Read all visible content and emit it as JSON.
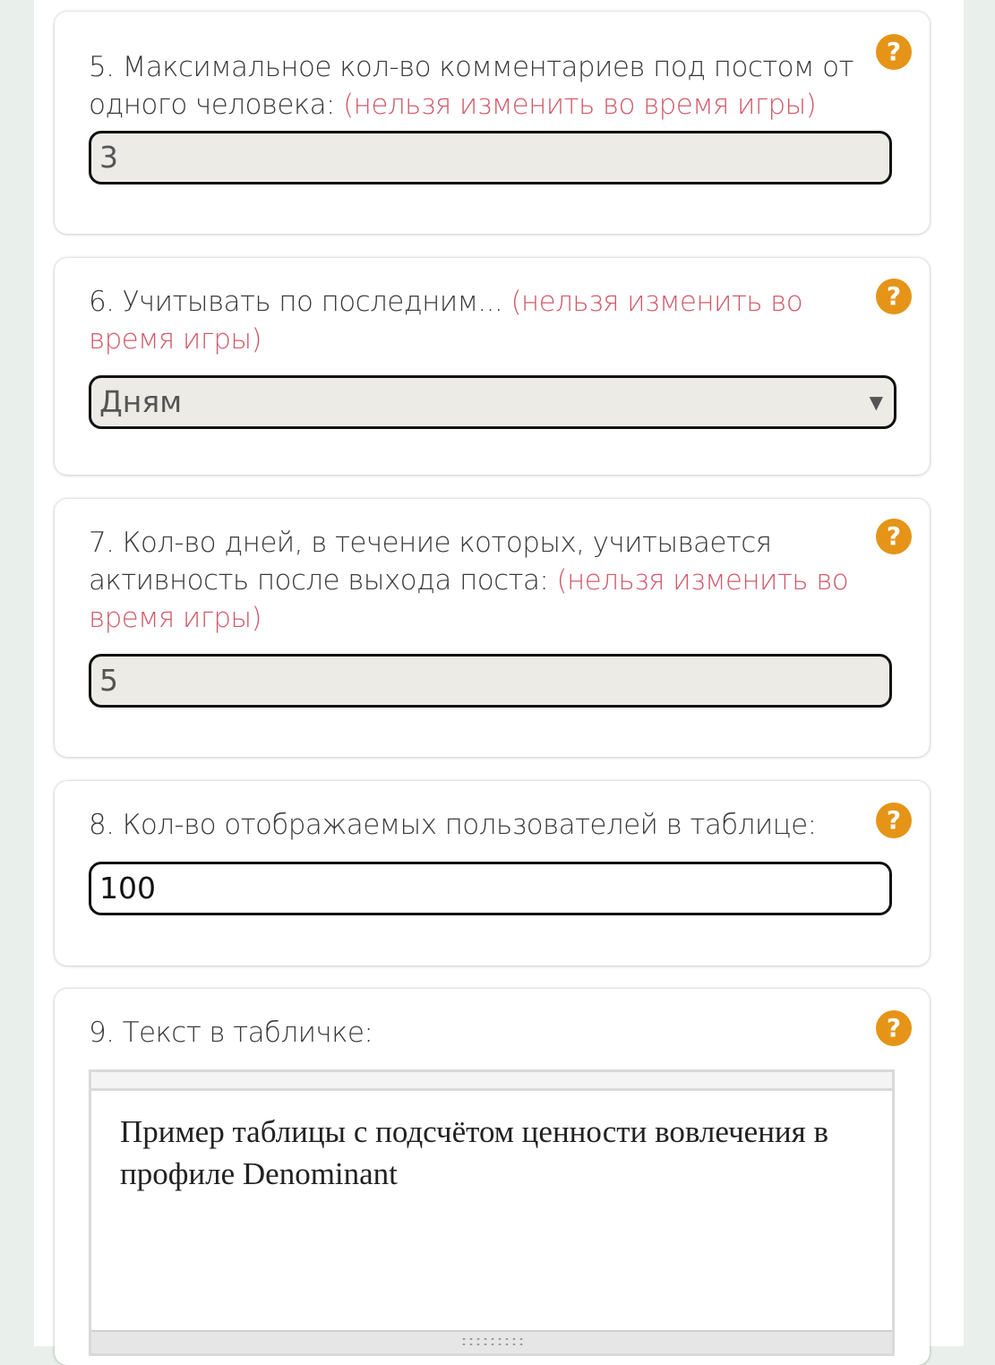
{
  "settings": [
    {
      "label": "5. Максимальное кол-во комментариев под постом от одного человека:",
      "warning": "(нельзя изменить во время игры)",
      "value": "3",
      "help": "?"
    },
    {
      "label": "6. Учитывать по последним...",
      "warning": "(нельзя изменить во время игры)",
      "value": "Дням",
      "arrow": "▼",
      "help": "?"
    },
    {
      "label": "7. Кол-во дней, в течение которых, учитывается активность после выхода поста:",
      "warning": "(нельзя изменить во время игры)",
      "value": "5",
      "help": "?"
    },
    {
      "label": "8. Кол-во отображаемых пользователей в таблице:",
      "value": "100",
      "help": "?"
    },
    {
      "label": "9. Текст в табличке:",
      "value": "Пример таблицы с подсчётом ценности вовлечения в профиле Denominant",
      "help": "?"
    }
  ],
  "colors": {
    "warning": "#d05a6a",
    "help_icon": "#e59417",
    "disabled_field": "#ecebe5"
  }
}
